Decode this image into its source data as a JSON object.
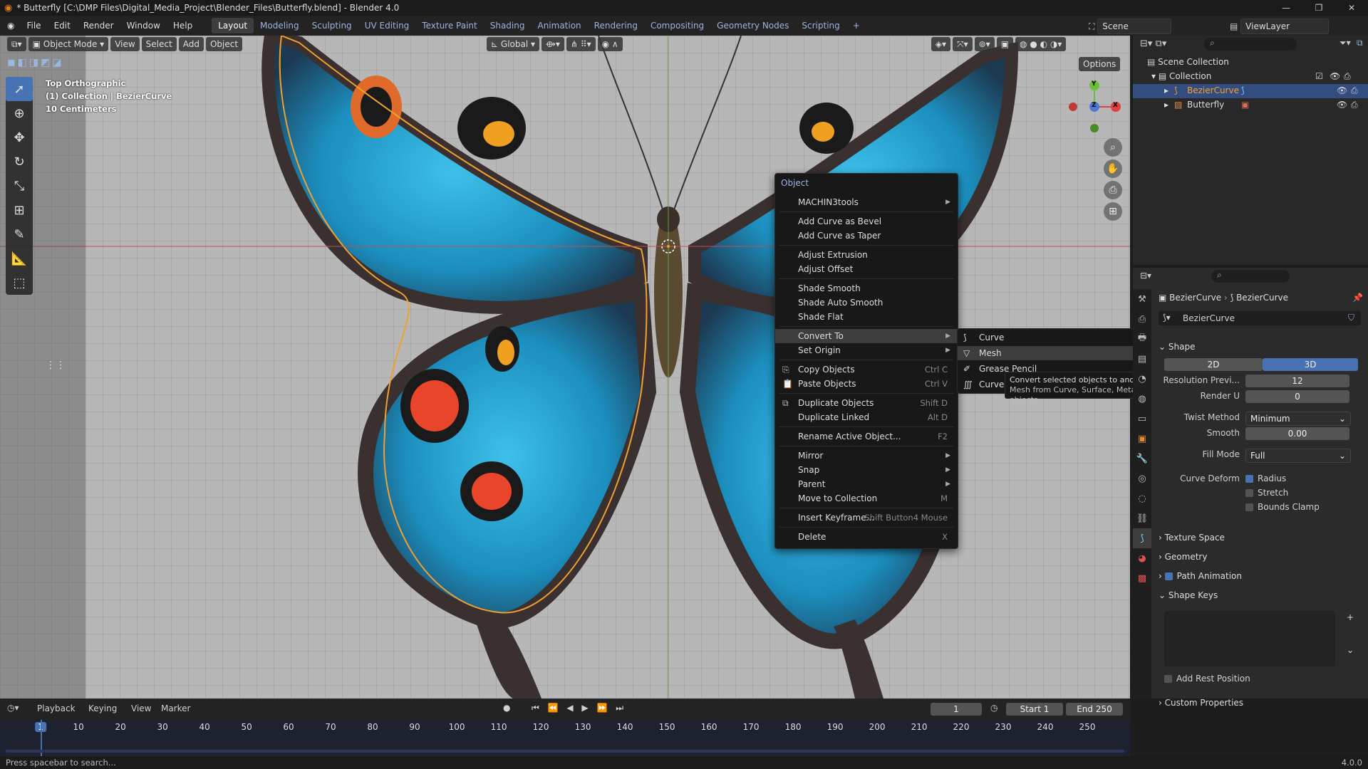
{
  "window": {
    "title": "* Butterfly [C:\\DMP Files\\Digital_Media_Project\\Blender_Files\\Butterfly.blend] - Blender 4.0",
    "controls": [
      "—",
      "❐",
      "✕"
    ]
  },
  "menubar": {
    "menus": [
      "File",
      "Edit",
      "Render",
      "Window",
      "Help"
    ],
    "workspaces": [
      "Layout",
      "Modeling",
      "Sculpting",
      "UV Editing",
      "Texture Paint",
      "Shading",
      "Animation",
      "Rendering",
      "Compositing",
      "Geometry Nodes",
      "Scripting"
    ],
    "active_workspace": "Layout",
    "add_tab": "+",
    "scene": "Scene",
    "view_layer": "ViewLayer"
  },
  "viewport_header": {
    "mode": "Object Mode",
    "menus": [
      "View",
      "Select",
      "Add",
      "Object"
    ],
    "orientation": "Global",
    "options": "Options"
  },
  "viewport_info": {
    "view": "Top Orthographic",
    "collection": "(1) Collection | BezierCurve",
    "scale": "10 Centimeters"
  },
  "gizmo": {
    "y": "Y",
    "z": "Z",
    "x": "X"
  },
  "context_menu": {
    "title": "Object",
    "items": [
      {
        "label": "MACHIN3tools",
        "shortcut": "",
        "submenu": true
      },
      {
        "label": "Add Curve as Bevel",
        "shortcut": ""
      },
      {
        "label": "Add Curve as Taper",
        "shortcut": ""
      },
      {
        "label": "Adjust Extrusion",
        "shortcut": ""
      },
      {
        "label": "Adjust Offset",
        "shortcut": ""
      },
      {
        "label": "Shade Smooth",
        "shortcut": ""
      },
      {
        "label": "Shade Auto Smooth",
        "shortcut": ""
      },
      {
        "label": "Shade Flat",
        "shortcut": ""
      },
      {
        "label": "Convert To",
        "shortcut": "",
        "submenu": true
      },
      {
        "label": "Set Origin",
        "shortcut": "",
        "submenu": true
      },
      {
        "label": "Copy Objects",
        "shortcut": "Ctrl C"
      },
      {
        "label": "Paste Objects",
        "shortcut": "Ctrl V"
      },
      {
        "label": "Duplicate Objects",
        "shortcut": "Shift D"
      },
      {
        "label": "Duplicate Linked",
        "shortcut": "Alt D"
      },
      {
        "label": "Rename Active Object...",
        "shortcut": "F2"
      },
      {
        "label": "Mirror",
        "shortcut": "",
        "submenu": true
      },
      {
        "label": "Snap",
        "shortcut": "",
        "submenu": true
      },
      {
        "label": "Parent",
        "shortcut": "",
        "submenu": true
      },
      {
        "label": "Move to Collection",
        "shortcut": "M"
      },
      {
        "label": "Insert Keyframe...",
        "shortcut": "Shift Button4 Mouse"
      },
      {
        "label": "Delete",
        "shortcut": "X"
      }
    ]
  },
  "convert_submenu": {
    "items": [
      "Curve",
      "Mesh",
      "Grease Pencil",
      "Curves"
    ]
  },
  "tooltip": {
    "line1": "Convert selected objects to another type:  Mesh",
    "line2": "Mesh from Curve, Surface, Metaball, or Text objects"
  },
  "outliner": {
    "root": "Scene Collection",
    "collection": "Collection",
    "objects": [
      "BezierCurve",
      "Butterfly"
    ]
  },
  "properties": {
    "breadcrumb_obj": "BezierCurve",
    "breadcrumb_data": "BezierCurve",
    "datablock": "BezierCurve",
    "shape_header": "Shape",
    "dim_2d": "2D",
    "dim_3d": "3D",
    "preview_label": "Resolution Previ...",
    "preview_value": "12",
    "render_u_label": "Render U",
    "render_u_value": "0",
    "twist_label": "Twist Method",
    "twist_value": "Minimum",
    "smooth_label": "Smooth",
    "smooth_value": "0.00",
    "fill_label": "Fill Mode",
    "fill_value": "Full",
    "deform_label": "Curve Deform",
    "radius": "Radius",
    "stretch": "Stretch",
    "bounds_clamp": "Bounds Clamp",
    "texture_space": "Texture Space",
    "geometry": "Geometry",
    "path_animation": "Path Animation",
    "shape_keys": "Shape Keys",
    "add_rest_position": "Add Rest Position",
    "custom_properties": "Custom Properties"
  },
  "timeline": {
    "menus": [
      "Playback",
      "Keying",
      "View",
      "Marker"
    ],
    "current_frame": "1",
    "start_label": "Start",
    "start": "1",
    "end_label": "End",
    "end": "250",
    "ticks": [
      "1",
      "10",
      "20",
      "30",
      "40",
      "50",
      "60",
      "70",
      "80",
      "90",
      "100",
      "110",
      "120",
      "130",
      "140",
      "150",
      "160",
      "170",
      "180",
      "190",
      "200",
      "210",
      "220",
      "230",
      "240",
      "250"
    ]
  },
  "status": {
    "hint": "Press spacebar to search...",
    "version": "4.0.0"
  },
  "colors": {
    "accent": "#4772b3",
    "selection_orange": "#f0a030",
    "wing_blue": "#2aa6d6"
  }
}
